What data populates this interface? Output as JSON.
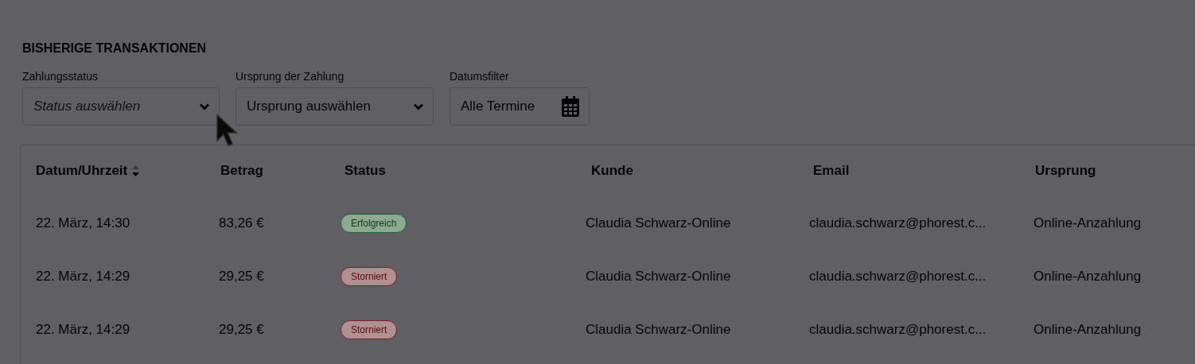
{
  "section_title": "BISHERIGE TRANSAKTIONEN",
  "filters": [
    {
      "kind": "select",
      "label": "Zahlungsstatus",
      "placeholder": "Status auswählen"
    },
    {
      "kind": "select",
      "label": "Ursprung der Zahlung",
      "value": "Ursprung auswählen"
    },
    {
      "kind": "date",
      "label": "Datumsfilter",
      "value": "Alle Termine"
    }
  ],
  "table": {
    "columns": [
      {
        "label": "Datum/Uhrzeit",
        "sortable": true
      },
      {
        "label": "Betrag",
        "sortable": false
      },
      {
        "label": "Status",
        "sortable": false
      },
      {
        "label": "Kunde",
        "sortable": false
      },
      {
        "label": "Email",
        "sortable": false
      },
      {
        "label": "Ursprung",
        "sortable": false
      }
    ],
    "rows": [
      {
        "date": "22. März, 14:30",
        "amount": "83,26 €",
        "status": {
          "label": "Erfolgreich",
          "kind": "success"
        },
        "customer": "Claudia Schwarz-Online",
        "email": "claudia.schwarz@phorest.c...",
        "origin": "Online-Anzahlung"
      },
      {
        "date": "22. März, 14:29",
        "amount": "29,25 €",
        "status": {
          "label": "Storniert",
          "kind": "cancelled"
        },
        "customer": "Claudia Schwarz-Online",
        "email": "claudia.schwarz@phorest.c...",
        "origin": "Online-Anzahlung"
      },
      {
        "date": "22. März, 14:29",
        "amount": "29,25 €",
        "status": {
          "label": "Storniert",
          "kind": "cancelled"
        },
        "customer": "Claudia Schwarz-Online",
        "email": "claudia.schwarz@phorest.c...",
        "origin": "Online-Anzahlung"
      }
    ]
  }
}
